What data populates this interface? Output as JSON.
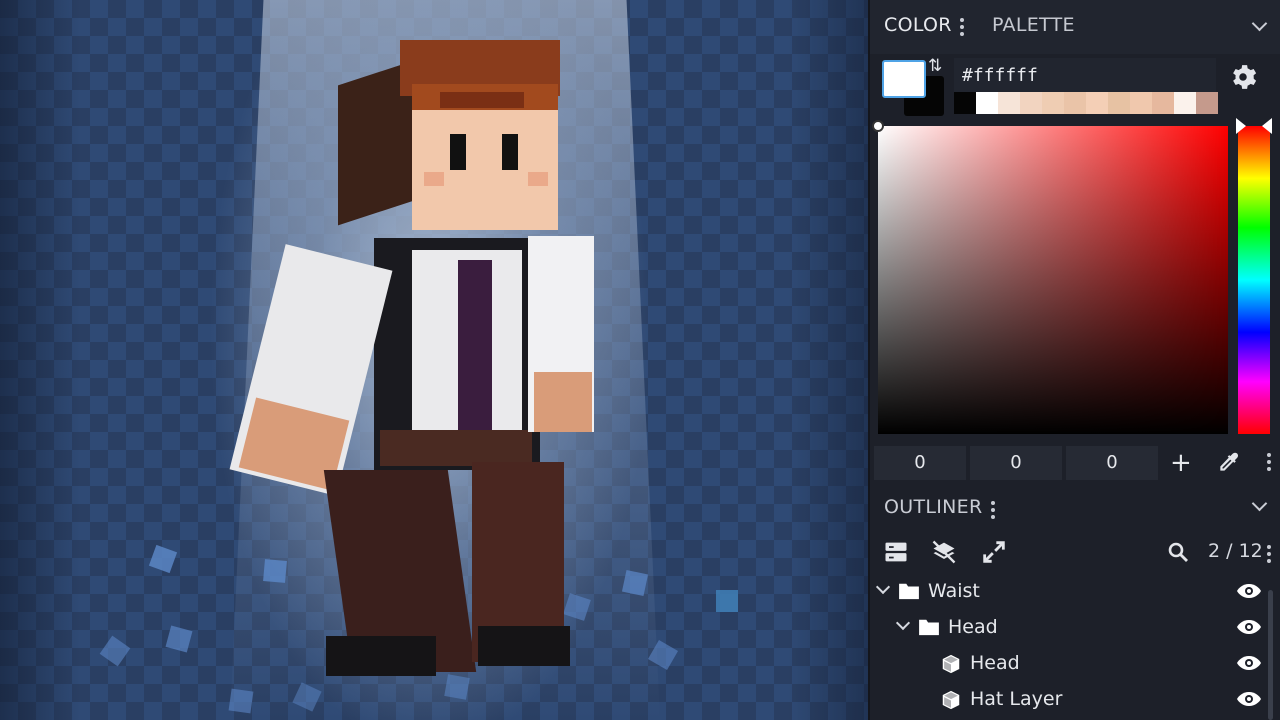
{
  "color_panel": {
    "tabs": [
      {
        "label": "COLOR"
      },
      {
        "label": "PALETTE"
      }
    ],
    "hex_value": "#ffffff",
    "primary_color": "#ffffff",
    "secondary_color": "#050505",
    "recent_colors": [
      "#050505",
      "#ffffff",
      "#f6e4d8",
      "#f2d4c0",
      "#efcdb3",
      "#eac4a8",
      "#f4cfb6",
      "#e7c2a3",
      "#f0c8ad",
      "#e6b89e",
      "#fbf2ec",
      "#c59a8c"
    ],
    "rgb": {
      "r": "0",
      "g": "0",
      "b": "0"
    },
    "add_label": "+",
    "icons": {
      "swap": "swap-icon",
      "settings": "gear-icon",
      "eyedropper": "eyedropper-icon"
    }
  },
  "outliner": {
    "title": "OUTLINER",
    "count": "2 / 12",
    "tree": [
      {
        "label": "Waist",
        "type": "group",
        "depth": 0
      },
      {
        "label": "Head",
        "type": "group",
        "depth": 1
      },
      {
        "label": "Head",
        "type": "cube",
        "depth": 2
      },
      {
        "label": "Hat Layer",
        "type": "cube",
        "depth": 2
      }
    ]
  },
  "theme": {
    "accent": "#4fa3e6",
    "panel_bg": "#1d2029",
    "tab_bg": "#21252f"
  }
}
